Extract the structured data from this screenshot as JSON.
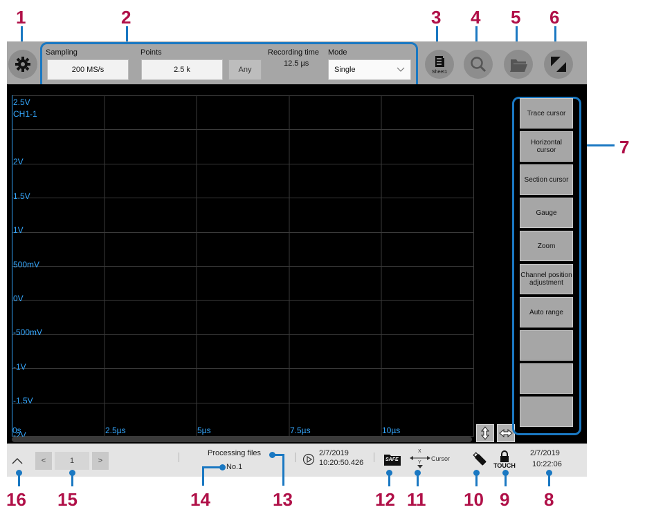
{
  "callouts": [
    "1",
    "2",
    "3",
    "4",
    "5",
    "6",
    "7",
    "8",
    "9",
    "10",
    "11",
    "12",
    "13",
    "14",
    "15",
    "16"
  ],
  "toolbar": {
    "sampling_label": "Sampling",
    "sampling_value": "200 MS/s",
    "points_label": "Points",
    "points_value": "2.5 k",
    "any_label": "Any",
    "recording_time_label": "Recording time",
    "recording_time_value": "12.5 µs",
    "mode_label": "Mode",
    "mode_value": "Single",
    "sheet_label": "Sheet1"
  },
  "graph": {
    "channel": "CH1-1",
    "y_labels": [
      "2.5V",
      "2V",
      "1.5V",
      "1V",
      "500mV",
      "0V",
      "-500mV",
      "-1V",
      "-1.5V",
      "-2V"
    ],
    "x_labels": [
      "0s",
      "2.5µs",
      "5µs",
      "7.5µs",
      "10µs"
    ],
    "colors": {
      "axis_text": "#35a8ff",
      "grid": "#3a3a3a",
      "background": "#000000"
    }
  },
  "side_menu": [
    "Trace cursor",
    "Horizontal cursor",
    "Section cursor",
    "Gauge",
    "Zoom",
    "Channel position adjustment",
    "Auto range",
    "",
    "",
    ""
  ],
  "status_bar": {
    "page_prev": "<",
    "page_number": "1",
    "page_next": ">",
    "processing_files_label": "Processing files",
    "processing_file_no": "No.1",
    "start_date": "2/7/2019",
    "start_time": "10:20:50.426",
    "safe_label": "SAFE",
    "cursor_label": "Cursor",
    "cursor_x": "X",
    "cursor_y": "Y",
    "touch_label": "TOUCH",
    "clock_date": "2/7/2019",
    "clock_time": "10:22:06"
  },
  "accent_color": "#1a78c2",
  "callout_color": "#b01048"
}
